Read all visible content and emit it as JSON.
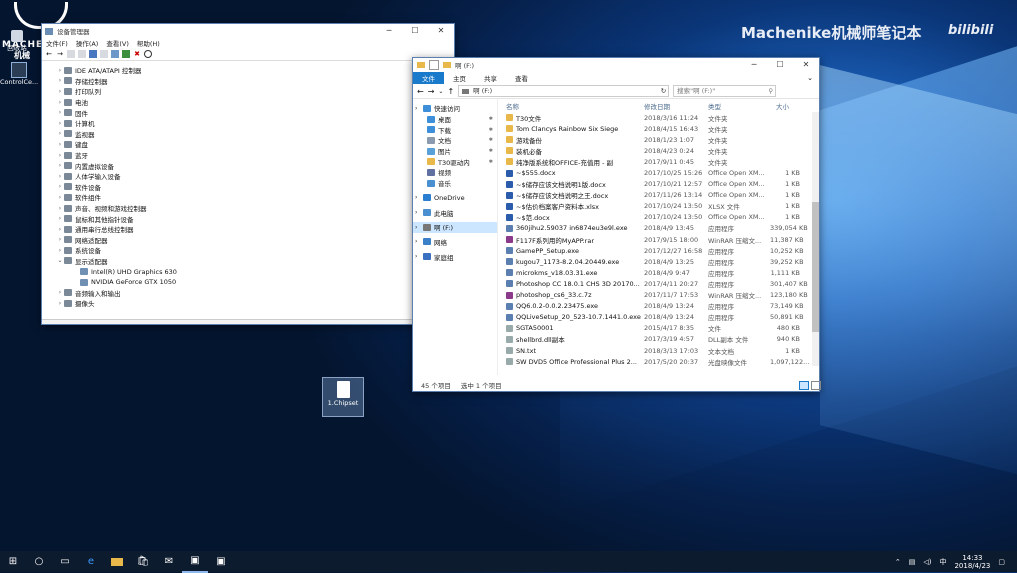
{
  "watermark": {
    "brand": "Machenike机械师笔记本",
    "site": "bilibili"
  },
  "corner_logo": {
    "line1": "MACHE",
    "line2": "机械"
  },
  "desktop_icons": [
    {
      "label": "回收站",
      "icon": "recycle-bin-icon"
    },
    {
      "label": "ControlCe...",
      "icon": "control-center-icon"
    },
    {
      "label": "1.Chipset",
      "icon": "file-icon"
    }
  ],
  "device_manager": {
    "title": "设备管理器",
    "menu": [
      "文件(F)",
      "操作(A)",
      "查看(V)",
      "帮助(H)"
    ],
    "tree": [
      {
        "label": "IDE ATA/ATAPI 控制器",
        "expanded": false,
        "indent": 0
      },
      {
        "label": "存储控制器",
        "expanded": false,
        "indent": 0
      },
      {
        "label": "打印队列",
        "expanded": false,
        "indent": 0
      },
      {
        "label": "电池",
        "expanded": false,
        "indent": 0
      },
      {
        "label": "固件",
        "expanded": false,
        "indent": 0
      },
      {
        "label": "计算机",
        "expanded": false,
        "indent": 0
      },
      {
        "label": "监视器",
        "expanded": false,
        "indent": 0
      },
      {
        "label": "键盘",
        "expanded": false,
        "indent": 0
      },
      {
        "label": "蓝牙",
        "expanded": false,
        "indent": 0
      },
      {
        "label": "内置虚拟设备",
        "expanded": false,
        "indent": 0
      },
      {
        "label": "人体学输入设备",
        "expanded": false,
        "indent": 0
      },
      {
        "label": "软件设备",
        "expanded": false,
        "indent": 0
      },
      {
        "label": "软件组件",
        "expanded": false,
        "indent": 0
      },
      {
        "label": "声音、视频和游戏控制器",
        "expanded": false,
        "indent": 0
      },
      {
        "label": "鼠标和其他指针设备",
        "expanded": false,
        "indent": 0
      },
      {
        "label": "通用串行总线控制器",
        "expanded": false,
        "indent": 0
      },
      {
        "label": "网络适配器",
        "expanded": false,
        "indent": 0
      },
      {
        "label": "系统设备",
        "expanded": false,
        "indent": 0
      },
      {
        "label": "显示适配器",
        "expanded": true,
        "indent": 0
      },
      {
        "label": "Intel(R) UHD Graphics 630",
        "expanded": null,
        "indent": 1
      },
      {
        "label": "NVIDIA GeForce GTX 1050",
        "expanded": null,
        "indent": 1
      },
      {
        "label": "音频输入和输出",
        "expanded": false,
        "indent": 0
      },
      {
        "label": "摄像头",
        "expanded": false,
        "indent": 0
      }
    ]
  },
  "explorer": {
    "title": "啊 (F:)",
    "ribbon_tabs": [
      "文件",
      "主页",
      "共享",
      "查看"
    ],
    "address": "啊 (F:)",
    "search_placeholder": "搜索\"啊 (F:)\"",
    "columns": [
      "名称",
      "修改日期",
      "类型",
      "大小"
    ],
    "nav": [
      {
        "label": "快速访问",
        "icon": "star-icon",
        "indent": 0,
        "selected": false,
        "pin": false
      },
      {
        "label": "桌面",
        "icon": "desktop-icon",
        "indent": 1,
        "selected": false,
        "pin": true
      },
      {
        "label": "下载",
        "icon": "download-icon",
        "indent": 1,
        "selected": false,
        "pin": true
      },
      {
        "label": "文档",
        "icon": "document-icon",
        "indent": 1,
        "selected": false,
        "pin": true
      },
      {
        "label": "图片",
        "icon": "picture-icon",
        "indent": 1,
        "selected": false,
        "pin": true
      },
      {
        "label": "T30驱动内",
        "icon": "folder-icon",
        "indent": 1,
        "selected": false,
        "pin": true
      },
      {
        "label": "视频",
        "icon": "video-icon",
        "indent": 1,
        "selected": false,
        "pin": false
      },
      {
        "label": "音乐",
        "icon": "music-icon",
        "indent": 1,
        "selected": false,
        "pin": false
      },
      {
        "label": "",
        "icon": "",
        "indent": 0,
        "selected": false,
        "pin": false
      },
      {
        "label": "OneDrive",
        "icon": "cloud-icon",
        "indent": 0,
        "selected": false,
        "pin": false
      },
      {
        "label": "",
        "icon": "",
        "indent": 0,
        "selected": false,
        "pin": false
      },
      {
        "label": "此电脑",
        "icon": "computer-icon",
        "indent": 0,
        "selected": false,
        "pin": false
      },
      {
        "label": "",
        "icon": "",
        "indent": 0,
        "selected": false,
        "pin": false
      },
      {
        "label": "啊 (F:)",
        "icon": "drive-icon",
        "indent": 0,
        "selected": true,
        "pin": false
      },
      {
        "label": "",
        "icon": "",
        "indent": 0,
        "selected": false,
        "pin": false
      },
      {
        "label": "网络",
        "icon": "network-icon",
        "indent": 0,
        "selected": false,
        "pin": false
      },
      {
        "label": "",
        "icon": "",
        "indent": 0,
        "selected": false,
        "pin": false
      },
      {
        "label": "家庭组",
        "icon": "homegroup-icon",
        "indent": 0,
        "selected": false,
        "pin": false
      }
    ],
    "files": [
      {
        "name": "T30文件",
        "date": "2018/3/16 11:24",
        "type": "文件夹",
        "size": "",
        "kind": "folder"
      },
      {
        "name": "Tom Clancys Rainbow Six Siege",
        "date": "2018/4/15 16:43",
        "type": "文件夹",
        "size": "",
        "kind": "folder"
      },
      {
        "name": "游戏备份",
        "date": "2018/1/23 1:07",
        "type": "文件夹",
        "size": "",
        "kind": "folder"
      },
      {
        "name": "装机必备",
        "date": "2018/4/23 0:24",
        "type": "文件夹",
        "size": "",
        "kind": "folder"
      },
      {
        "name": "纯净版系统和OFFICE-充值用 - 副",
        "date": "2017/9/11 0:45",
        "type": "文件夹",
        "size": "",
        "kind": "folder"
      },
      {
        "name": "~$555.docx",
        "date": "2017/10/25 15:26",
        "type": "Office Open XM...",
        "size": "1 KB",
        "kind": "doc"
      },
      {
        "name": "~$储存应该文档说明1版.docx",
        "date": "2017/10/21 12:57",
        "type": "Office Open XM...",
        "size": "1 KB",
        "kind": "doc"
      },
      {
        "name": "~$储存应该文档说明之王.docx",
        "date": "2017/11/26 13:14",
        "type": "Office Open XM...",
        "size": "1 KB",
        "kind": "doc"
      },
      {
        "name": "~$估价档案客户资料本.xlsx",
        "date": "2017/10/24 13:50",
        "type": "XLSX 文件",
        "size": "1 KB",
        "kind": "doc"
      },
      {
        "name": "~$范.docx",
        "date": "2017/10/24 13:50",
        "type": "Office Open XM...",
        "size": "1 KB",
        "kind": "doc"
      },
      {
        "name": "360jihu2.59037 in6874eu3e9l.exe",
        "date": "2018/4/9 13:45",
        "type": "应用程序",
        "size": "339,054 KB",
        "kind": "exe"
      },
      {
        "name": "F117F系列用的MyAPP.rar",
        "date": "2017/9/15 18:00",
        "type": "WinRAR 压缩文...",
        "size": "11,387 KB",
        "kind": "rar"
      },
      {
        "name": "GamePP_Setup.exe",
        "date": "2017/12/27 16:58",
        "type": "应用程序",
        "size": "10,252 KB",
        "kind": "exe"
      },
      {
        "name": "kugou7_1173-8.2.04.20449.exe",
        "date": "2018/4/9 13:25",
        "type": "应用程序",
        "size": "39,252 KB",
        "kind": "exe"
      },
      {
        "name": "microkms_v18.03.31.exe",
        "date": "2018/4/9 9:47",
        "type": "应用程序",
        "size": "1,111 KB",
        "kind": "exe"
      },
      {
        "name": "Photoshop CC 18.0.1 CHS 3D 20170...",
        "date": "2017/4/11 20:27",
        "type": "应用程序",
        "size": "301,407 KB",
        "kind": "exe"
      },
      {
        "name": "photoshop_cs6_33.c.7z",
        "date": "2017/11/7 17:53",
        "type": "WinRAR 压缩文...",
        "size": "123,180 KB",
        "kind": "rar"
      },
      {
        "name": "QQ6.0.2-0.0.2.23475.exe",
        "date": "2018/4/9 13:24",
        "type": "应用程序",
        "size": "73,149 KB",
        "kind": "exe"
      },
      {
        "name": "QQLiveSetup_20_523-10.7.1441.0.exe",
        "date": "2018/4/9 13:24",
        "type": "应用程序",
        "size": "50,891 KB",
        "kind": "exe"
      },
      {
        "name": "SGTA50001",
        "date": "2015/4/17 8:35",
        "type": "文件",
        "size": "480 KB",
        "kind": "file"
      },
      {
        "name": "shellbrd.dll副本",
        "date": "2017/3/19 4:57",
        "type": "DLL副本 文件",
        "size": "940 KB",
        "kind": "file"
      },
      {
        "name": "SN.txt",
        "date": "2018/3/13 17:03",
        "type": "文本文档",
        "size": "1 KB",
        "kind": "file"
      },
      {
        "name": "SW DVD5 Office Professional Plus 2...",
        "date": "2017/5/20 20:37",
        "type": "光盘映像文件",
        "size": "1,097,122...",
        "kind": "file"
      }
    ],
    "status_left": "45 个项目",
    "status_sel": "选中 1 个项目"
  },
  "taskbar": {
    "time": "14:33",
    "date": "2018/4/23",
    "tray_icons": [
      "network-icon",
      "volume-icon",
      "ime-icon"
    ]
  },
  "colors": {
    "accent": "#1979ca",
    "folder": "#e8b84a",
    "selection": "#cce6ff"
  }
}
